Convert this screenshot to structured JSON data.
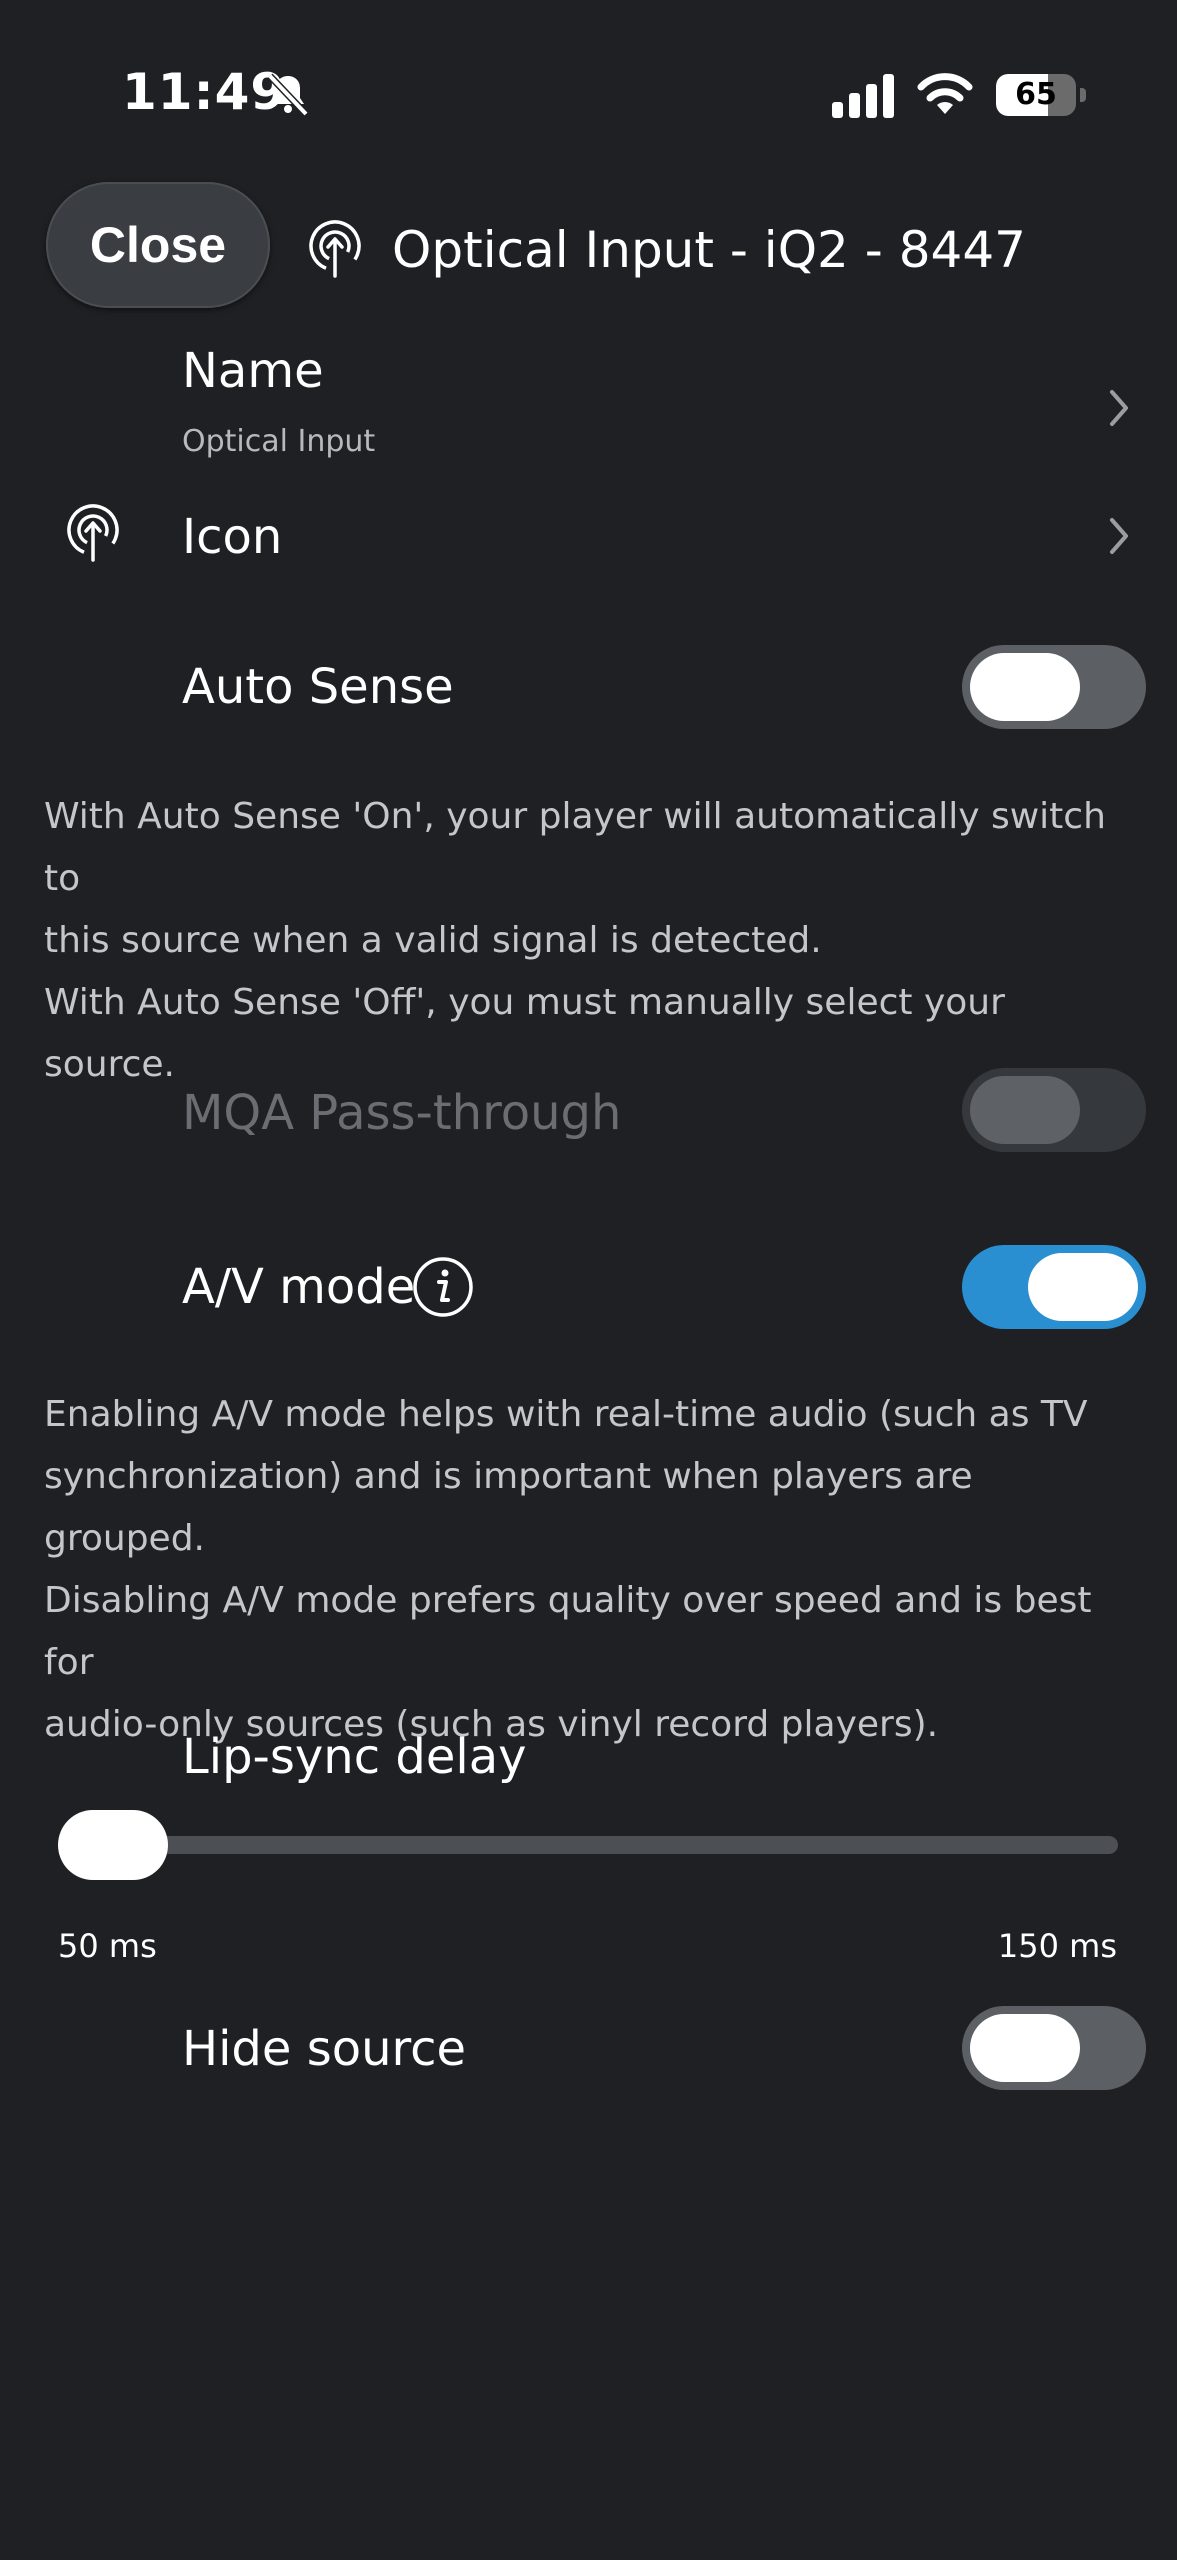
{
  "status_bar": {
    "time": "11:49",
    "battery": "65",
    "battery_level": 0.65
  },
  "header": {
    "close_label": "Close",
    "title": "Optical Input - iQ2 - 8447"
  },
  "settings": {
    "name_label": "Name",
    "name_value": "Optical Input",
    "icon_label": "Icon",
    "auto_sense_label": "Auto Sense",
    "auto_sense_on": false,
    "auto_sense_desc_1": "With Auto Sense 'On', your player will automatically switch to",
    "auto_sense_desc_2": "this source when a valid signal is detected.",
    "auto_sense_desc_3": "With Auto Sense 'Off', you must manually select your source.",
    "mqa_label": "MQA Pass-through",
    "mqa_on": false,
    "av_mode_label": "A/V mode",
    "av_mode_on": true,
    "av_desc_1": "Enabling A/V mode helps with real-time audio (such as TV",
    "av_desc_2": "synchronization) and is important when players are grouped.",
    "av_desc_3": "Disabling A/V mode prefers quality over speed and is best for",
    "av_desc_4": "audio-only sources (such as vinyl record players).",
    "lip_sync_label": "Lip-sync delay",
    "lip_sync_min": "50 ms",
    "lip_sync_max": "150 ms",
    "lip_sync_value": 50,
    "hide_source_label": "Hide source",
    "hide_source_on": false
  },
  "colors": {
    "background": "#1e2023",
    "accent": "#2a8fd0"
  },
  "icons": {
    "header": "optical-input-icon",
    "row_icon": "optical-input-icon",
    "chevron": "chevron-right-icon",
    "info": "info-icon",
    "bell": "bell-slash-icon"
  }
}
